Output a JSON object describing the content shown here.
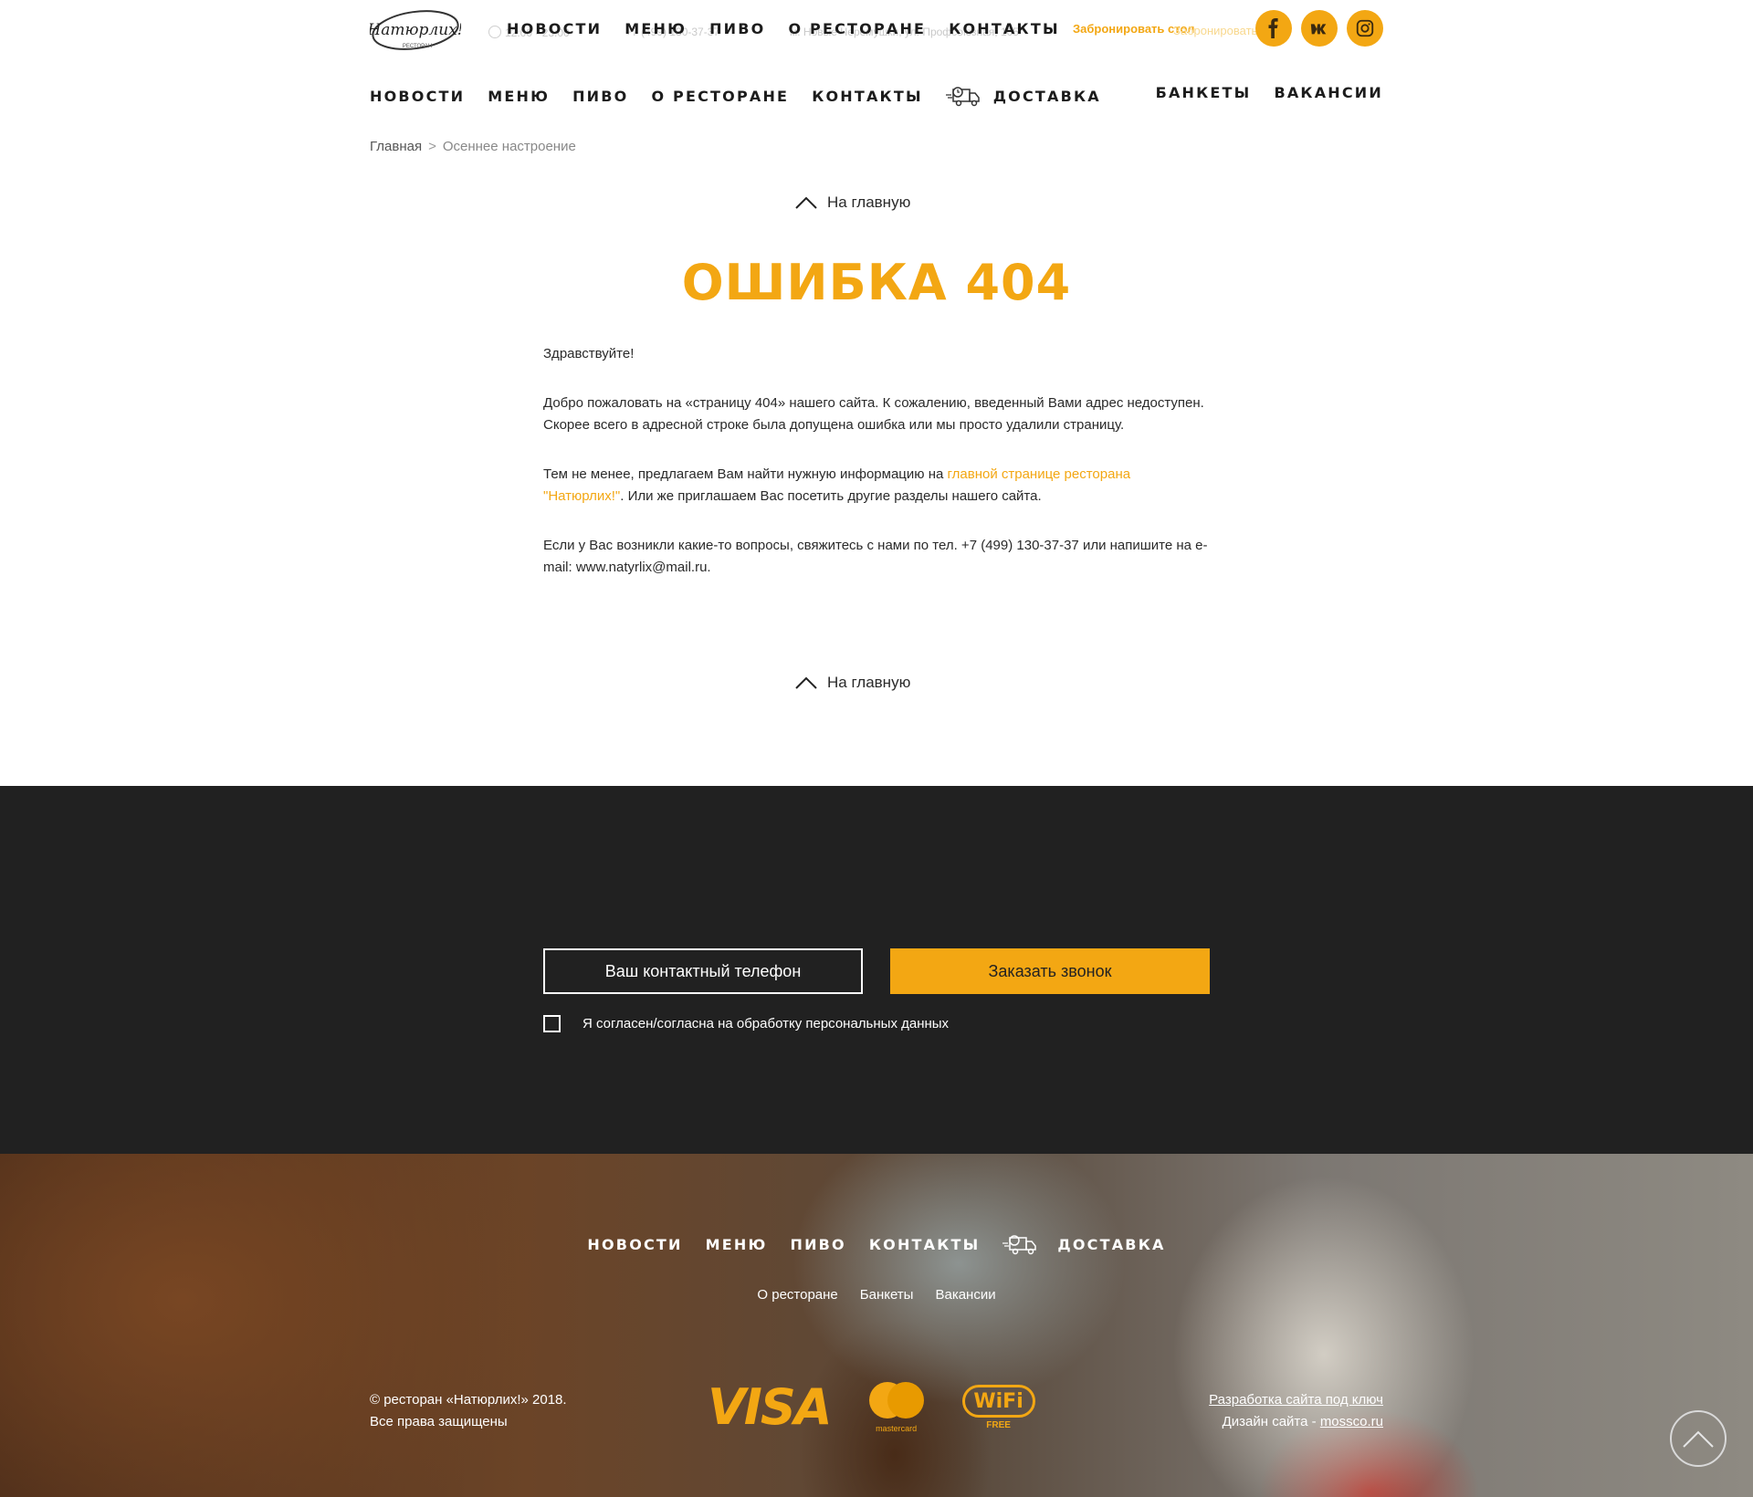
{
  "header": {
    "logo_text": "Натюрлих!",
    "logo_sub": "РЕСТОРАН",
    "ghost_hours": "12:00 - 23:00",
    "ghost_phone": "+7 (499) 130-37-37",
    "ghost_address": "м. Новые Черемушки, ул. Профсоюзная, 105",
    "overlay_nav": [
      "НОВОСТИ",
      "МЕНЮ",
      "ПИВО",
      "О РЕСТОРАНЕ",
      "КОНТАКТЫ"
    ],
    "book_table": "Забронировать стол",
    "book_table_ghost": "Забронировать стол",
    "social_icons": [
      "facebook-icon",
      "vk-icon",
      "instagram-icon"
    ]
  },
  "main_nav": {
    "left": [
      "НОВОСТИ",
      "МЕНЮ",
      "ПИВО",
      "О РЕСТОРАНЕ",
      "КОНТАКТЫ"
    ],
    "delivery": "ДОСТАВКА",
    "right": [
      "БАНКЕТЫ",
      "ВАКАНСИИ"
    ]
  },
  "breadcrumb": {
    "home": "Главная",
    "separator": ">",
    "current": "Осеннее настроение"
  },
  "home_link": "На главную",
  "title": "ОШИБКА 404",
  "content": {
    "greeting": "Здравствуйте!",
    "p1": "Добро пожаловать на «страницу 404» нашего сайта. К сожалению, введенный Вами адрес недоступен. Скорее всего в адресной строке была допущена ошибка или мы просто удалили страницу.",
    "p2_before": "Тем не менее, предлагаем Вам найти нужную информацию на ",
    "p2_link": "главной странице ресторана \"Натюрлих!\"",
    "p2_after": ". Или же приглашаем Вас посетить другие разделы нашего сайта.",
    "p3": "Если у Вас возникли какие-то вопросы, свяжитесь с нами по тел. +7 (499) 130-37-37 или напишите на e-mail: www.natyrlix@mail.ru."
  },
  "callback": {
    "phone_placeholder": "Ваш контактный телефон",
    "button": "Заказать звонок",
    "consent": "Я согласен/согласна на обработку персональных данных"
  },
  "footer": {
    "nav": [
      "НОВОСТИ",
      "МЕНЮ",
      "ПИВО",
      "КОНТАКТЫ"
    ],
    "delivery": "ДОСТАВКА",
    "sub": [
      "О ресторане",
      "Банкеты",
      "Вакансии"
    ],
    "copyright_line1": "© ресторан «Натюрлих!» 2018.",
    "copyright_line2": "Все права защищены",
    "visa": "VISA",
    "mastercard": "mastercard",
    "wifi": "WiFi",
    "wifi_free": "FREE",
    "dev_link": "Разработка сайта под ключ",
    "design_prefix": "Дизайн сайта - ",
    "design_link": "mossco.ru"
  },
  "colors": {
    "accent": "#f3a713",
    "dark": "#212121",
    "text": "#2a2a2a"
  }
}
